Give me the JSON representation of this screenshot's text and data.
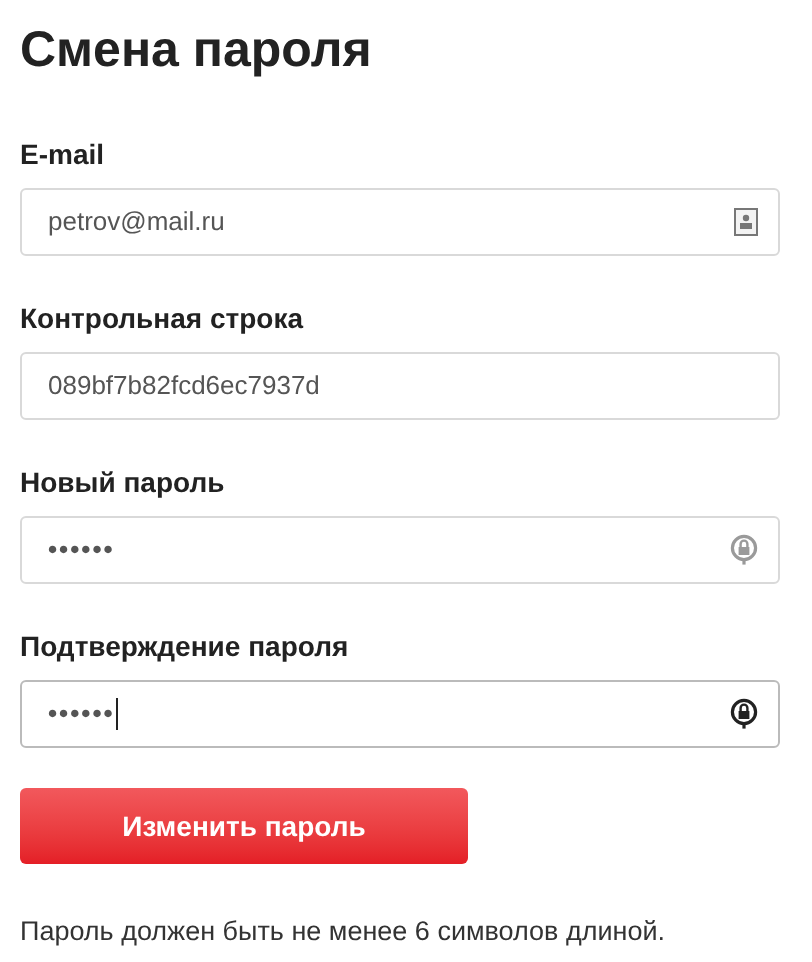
{
  "title": "Смена пароля",
  "fields": [
    {
      "label": "E-mail",
      "kind": "email",
      "value": "petrov@mail.ru",
      "focused": false
    },
    {
      "label": "Контрольная строка",
      "kind": "text",
      "value": "089bf7b82fcd6ec7937d",
      "focused": false
    },
    {
      "label": "Новый пароль",
      "kind": "password",
      "value": "••••••",
      "focused": false
    },
    {
      "label": "Подтверждение пароля",
      "kind": "password",
      "value": "••••••",
      "focused": true
    }
  ],
  "submit_button": "Изменить пароль",
  "note": "Пароль должен быть не менее 6 символов длиной."
}
